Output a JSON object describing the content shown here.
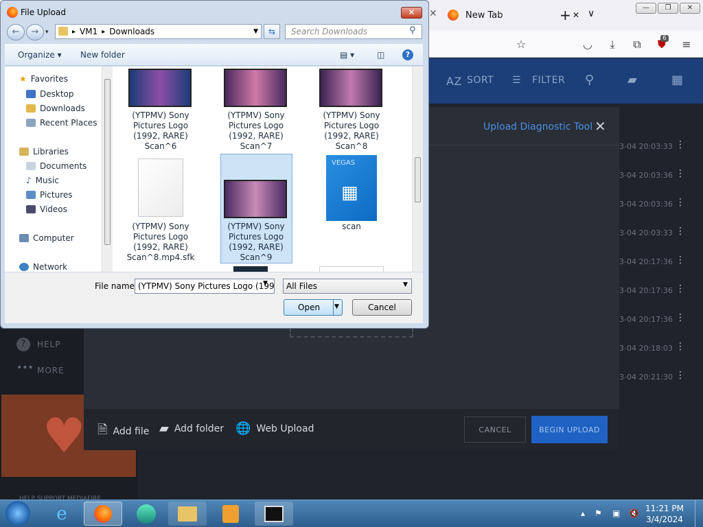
{
  "browser": {
    "tab_title": "New Tab",
    "tab_close": "✕",
    "new_tab": "+",
    "tab_list": "∨",
    "toolbar_badge": "6"
  },
  "app": {
    "toolbar": {
      "sort": "SORT",
      "filter": "FILTER",
      "sort_icon": "AZ"
    },
    "sidebar": {
      "help": "HELP",
      "more": "MORE",
      "footer": "HELP SUPPORT MEDIAFIRE"
    },
    "modal": {
      "title": "Upload Diagnostic Tool",
      "add_file": "Add file",
      "add_folder": "Add folder",
      "web_upload": "Web Upload",
      "cancel": "CANCEL",
      "begin": "BEGIN UPLOAD"
    },
    "row_times": [
      "3-04 20:03:33",
      "3-04 20:03:36",
      "3-04 20:03:36",
      "3-04 20:03:33",
      "3-04 20:17:36",
      "3-04 20:17:36",
      "3-04 20:17:36",
      "3-04 20:18:03",
      "3-04 20:21:30"
    ]
  },
  "dialog": {
    "title": "File Upload",
    "path": [
      "VM1",
      "Downloads"
    ],
    "search_placeholder": "Search Downloads",
    "organize": "Organize",
    "new_folder": "New folder",
    "nav": {
      "favorites": "Favorites",
      "desktop": "Desktop",
      "downloads": "Downloads",
      "recent": "Recent Places",
      "libraries": "Libraries",
      "documents": "Documents",
      "music": "Music",
      "pictures": "Pictures",
      "videos": "Videos",
      "computer": "Computer",
      "network": "Network"
    },
    "files": [
      {
        "lines": [
          "(YTPMV) Sony",
          "Pictures Logo",
          "(1992, RARE)",
          "Scan^6"
        ]
      },
      {
        "lines": [
          "(YTPMV) Sony",
          "Pictures Logo",
          "(1992, RARE)",
          "Scan^7"
        ]
      },
      {
        "lines": [
          "(YTPMV) Sony",
          "Pictures Logo",
          "(1992, RARE)",
          "Scan^8"
        ]
      },
      {
        "lines": [
          "(YTPMV) Sony",
          "Pictures Logo",
          "(1992, RARE)",
          "Scan^8.mp4.sfk"
        ]
      },
      {
        "lines": [
          "(YTPMV) Sony",
          "Pictures Logo",
          "(1992, RARE)",
          "Scan^9"
        ]
      },
      {
        "lines": [
          "scan"
        ],
        "badge": "VEGAS"
      }
    ],
    "file_name_label": "File name:",
    "file_name_value": "(YTPMV) Sony Pictures Logo (1992",
    "file_type": "All Files",
    "open": "Open",
    "cancel": "Cancel"
  },
  "taskbar": {
    "time": "11:21 PM",
    "date": "3/4/2024"
  }
}
